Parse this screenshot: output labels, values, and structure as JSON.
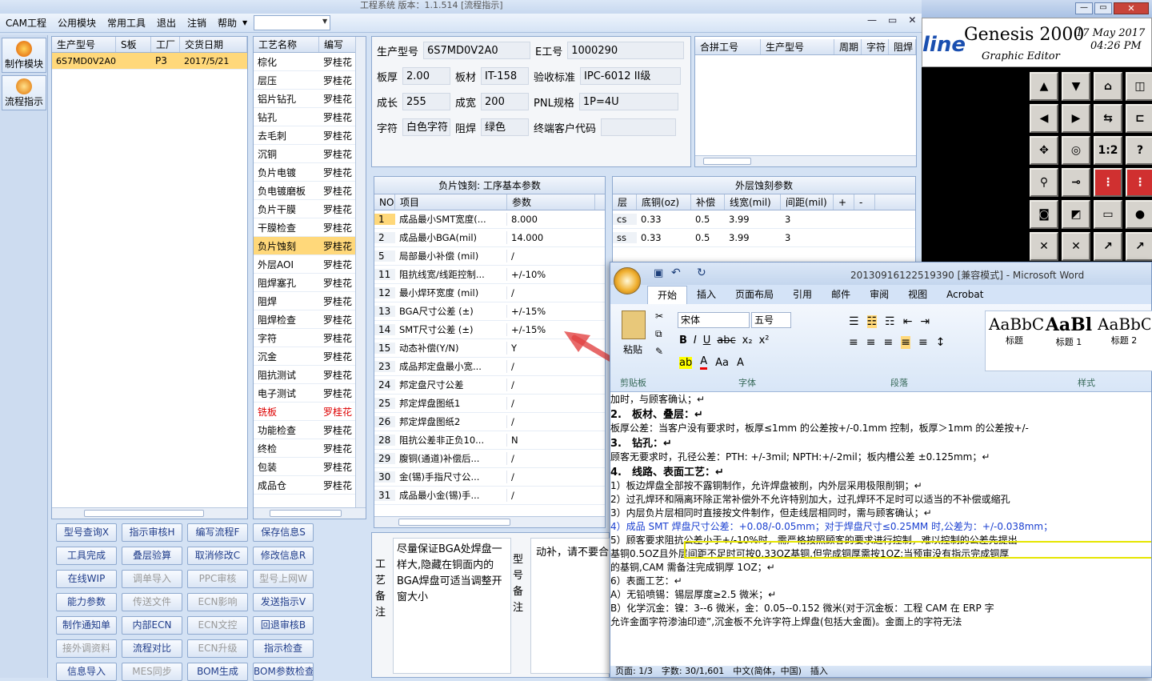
{
  "window": {
    "title_partial": "工程系统  版本：1.1.514  [流程指示]",
    "min": "—",
    "max": "▭",
    "close": "✕"
  },
  "menu": [
    "CAM工程",
    "公用模块",
    "常用工具",
    "退出",
    "注销",
    "帮助"
  ],
  "nav": [
    {
      "label": "制作模块"
    },
    {
      "label": "流程指示"
    }
  ],
  "orders": {
    "headers": [
      "生产型号",
      "S板",
      "工厂",
      "交货日期"
    ],
    "rows": [
      [
        "6S7MD0V2A0",
        "",
        "P3",
        "2017/5/21"
      ]
    ]
  },
  "process": {
    "headers": [
      "工艺名称",
      "编写"
    ],
    "rows": [
      [
        "棕化",
        "罗桂花"
      ],
      [
        "层压",
        "罗桂花"
      ],
      [
        "铝片钻孔",
        "罗桂花"
      ],
      [
        "钻孔",
        "罗桂花"
      ],
      [
        "去毛刺",
        "罗桂花"
      ],
      [
        "沉铜",
        "罗桂花"
      ],
      [
        "负片电镀",
        "罗桂花"
      ],
      [
        "负电镀磨板",
        "罗桂花"
      ],
      [
        "负片干膜",
        "罗桂花"
      ],
      [
        "干膜检查",
        "罗桂花"
      ],
      [
        "负片蚀刻",
        "罗桂花"
      ],
      [
        "外层AOI",
        "罗桂花"
      ],
      [
        "阻焊塞孔",
        "罗桂花"
      ],
      [
        "阻焊",
        "罗桂花"
      ],
      [
        "阻焊检查",
        "罗桂花"
      ],
      [
        "字符",
        "罗桂花"
      ],
      [
        "沉金",
        "罗桂花"
      ],
      [
        "阻抗测试",
        "罗桂花"
      ],
      [
        "电子测试",
        "罗桂花"
      ],
      [
        "铣板",
        "罗桂花"
      ],
      [
        "功能检查",
        "罗桂花"
      ],
      [
        "终检",
        "罗桂花"
      ],
      [
        "包装",
        "罗桂花"
      ],
      [
        "成品仓",
        "罗桂花"
      ]
    ]
  },
  "info": {
    "model_label": "生产型号",
    "model": "6S7MD0V2A0",
    "e_label": "E工号",
    "e": "1000290",
    "thick_label": "板厚",
    "thick": "2.00",
    "mat_label": "板材",
    "mat": "IT-158",
    "std_label": "验收标准",
    "std": "IPC-6012 II级",
    "len_label": "成长",
    "len": "255",
    "wid_label": "成宽",
    "wid": "200",
    "pnl_label": "PNL规格",
    "pnl": "1P=4U",
    "char_label": "字符",
    "char": "白色字符",
    "mask_label": "阻焊",
    "mask": "绿色",
    "cust_label": "终端客户代码",
    "cust": ""
  },
  "combine": {
    "headers": [
      "合拼工号",
      "生产型号",
      "周期",
      "字符",
      "阻焊"
    ]
  },
  "params": {
    "title": "负片蚀刻: 工序基本参数",
    "headers": [
      "NO",
      "项目",
      "参数"
    ],
    "rows": [
      [
        "1",
        "成品最小SMT宽度(...",
        "8.000"
      ],
      [
        "2",
        "成品最小BGA(mil)",
        "14.000"
      ],
      [
        "5",
        "局部最小补偿 (mil)",
        "/"
      ],
      [
        "11",
        "阻抗线宽/线距控制...",
        "+/-10%"
      ],
      [
        "12",
        "最小焊环宽度 (mil)",
        "/"
      ],
      [
        "13",
        "BGA尺寸公差 (±)",
        "+/-15%"
      ],
      [
        "14",
        "SMT尺寸公差 (±)",
        "+/-15%"
      ],
      [
        "15",
        "动态补偿(Y/N)",
        "Y"
      ],
      [
        "23",
        "成品邦定盘最小宽...",
        "/"
      ],
      [
        "24",
        "邦定盘尺寸公差",
        "/"
      ],
      [
        "25",
        "邦定焊盘图纸1",
        "/"
      ],
      [
        "26",
        "邦定焊盘图纸2",
        "/"
      ],
      [
        "28",
        "阻抗公差非正负10...",
        "N"
      ],
      [
        "29",
        "腹铜(通道)补偿后...",
        "/"
      ],
      [
        "30",
        "金(锡)手指尺寸公...",
        "/"
      ],
      [
        "31",
        "成品最小金(锡)手...",
        "/"
      ]
    ]
  },
  "outer": {
    "title": "外层蚀刻参数",
    "headers": [
      "层",
      "底铜(oz)",
      "补偿",
      "线宽(mil)",
      "间距(mil)",
      "+",
      "-"
    ],
    "rows": [
      [
        "cs",
        "0.33",
        "0.5",
        "3.99",
        "3"
      ],
      [
        "ss",
        "0.33",
        "0.5",
        "3.99",
        "3"
      ]
    ]
  },
  "remarks": {
    "proc_label": "工艺备注",
    "proc_text": "尽量保证BGA处焊盘一样大,隐藏在铜面内的BGA焊盘可适当调整开窗大小",
    "model_label": "型号备注",
    "model_text": "动补，请不要合"
  },
  "buttons": [
    [
      "型号查询X",
      "指示审核H",
      "编写流程F",
      "保存信息S"
    ],
    [
      "工具完成",
      "叠层验算",
      "取消修改C",
      "修改信息R"
    ],
    [
      "在线WIP",
      "调单导入",
      "PPC审核",
      "型号上网W"
    ],
    [
      "能力参数",
      "传送文件",
      "ECN影响",
      "发送指示V"
    ],
    [
      "制作通知单",
      "内部ECN",
      "ECN文控",
      "回退审核B"
    ],
    [
      "接外调资料",
      "流程对比",
      "ECN升级",
      "指示检查"
    ],
    [
      "信息导入",
      "MES同步",
      "BOM生成",
      "BOM参数检查"
    ]
  ],
  "genesis": {
    "title": "Genesis 2000",
    "sub": "Graphic Editor",
    "partial": "line",
    "date": "17 May 2017",
    "time": "04:26 PM"
  },
  "word": {
    "title": "20130916122519390 [兼容模式] - Microsoft Word",
    "tabs": [
      "开始",
      "插入",
      "页面布局",
      "引用",
      "邮件",
      "审阅",
      "视图",
      "Acrobat"
    ],
    "font": "宋体",
    "size": "五号",
    "paste": "粘贴",
    "clipboard": "剪贴板",
    "font_group": "字体",
    "para_group": "段落",
    "style_group": "样式",
    "styles": [
      {
        "sample": "AaBbC",
        "name": "标题"
      },
      {
        "sample": "AaBl",
        "name": "标题 1"
      },
      {
        "sample": "AaBbC",
        "name": "标题 2"
      }
    ],
    "lines": [
      "加时，与顾客确认；↵",
      "2.　板材、叠层：↵",
      "板厚公差：当客户没有要求时，板厚≤1mm 的公差按+/-0.1mm 控制，板厚＞1mm 的公差按+/-",
      "3.　钻孔：↵",
      "顾客无要求时，孔径公差：PTH: +/-3mil; NPTH:+/-2mil；板内槽公差 ±0.125mm；↵",
      "4.　线路、表面工艺：↵",
      "1）板边焊盘全部按不露铜制作，允许焊盘被削，内外层采用极限削铜；↵",
      "2）过孔焊环和隔离环除正常补偿外不允许特别加大，过孔焊环不足时可以适当的不补偿或缩孔",
      "3）内层负片层相同时直接按文件制作，但走线层相同时，需与顾客确认；↵",
      "4）成品 SMT 焊盘尺寸公差：+0.08/-0.05mm；对于焊盘尺寸≤0.25MM 时,公差为：+/-0.038mm；",
      "5）顾客要求阻抗公差小于+/-10%时，需严格按照顾客的要求进行控制，难以控制的公差先提出",
      "基铜0.5OZ且外层间距不足时可按0.33OZ基铜,但完成铜厚需按1OZ;当预审没有指示完成铜厚",
      "的基铜,CAM 需备注完成铜厚 1OZ；↵",
      "6）表面工艺：↵",
      "A）无铅喷锡：锡层厚度≥2.5 微米；↵",
      "B）化学沉金：镍：3--6 微米，金：0.05--0.152 微米(对于沉金板：工程 CAM 在 ERP 字",
      "允许金面字符渗油印迹”,沉金板不允许字符上焊盘(包括大金面)。金面上的字符无法"
    ],
    "status": "页面: 1/3　字数: 30/1,601　中文(简体，中国)　插入"
  }
}
